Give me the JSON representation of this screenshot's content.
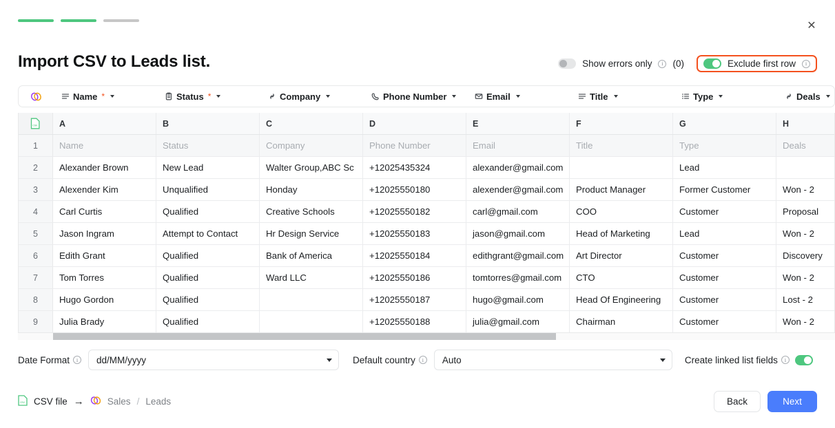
{
  "steps": [
    {
      "state": "done"
    },
    {
      "state": "done"
    },
    {
      "state": "todo"
    }
  ],
  "close_label": "✕",
  "title": "Import CSV to Leads list.",
  "header_controls": {
    "show_errors": {
      "label": "Show errors only",
      "count": "(0)",
      "on": false,
      "info": "ⓘ"
    },
    "exclude_first_row": {
      "label": "Exclude first row",
      "on": true,
      "highlighted": true
    }
  },
  "mapping": {
    "logo_icon": "twenty-logo-icon",
    "columns": [
      {
        "icon": "text-lines-icon",
        "label": "Name",
        "required": true
      },
      {
        "icon": "clipboard-icon",
        "label": "Status",
        "required": true
      },
      {
        "icon": "link-icon",
        "label": "Company",
        "required": false
      },
      {
        "icon": "phone-icon",
        "label": "Phone Number",
        "required": false
      },
      {
        "icon": "envelope-icon",
        "label": "Email",
        "required": false
      },
      {
        "icon": "text-lines-icon",
        "label": "Title",
        "required": false
      },
      {
        "icon": "list-icon",
        "label": "Type",
        "required": false
      },
      {
        "icon": "link-icon",
        "label": "Deals",
        "required": false
      }
    ]
  },
  "sheet": {
    "file_icon": "csv-file-icon",
    "column_letters": [
      "A",
      "B",
      "C",
      "D",
      "E",
      "F",
      "G",
      "H"
    ],
    "rows": [
      {
        "num": "1",
        "excluded": true,
        "cells": [
          "Name",
          "Status",
          "Company",
          "Phone Number",
          "Email",
          "Title",
          "Type",
          "Deals"
        ]
      },
      {
        "num": "2",
        "excluded": false,
        "cells": [
          "Alexander Brown",
          "New Lead",
          "Walter Group,ABC Sc",
          "+12025435324",
          "alexander@gmail.com",
          "",
          "Lead",
          ""
        ]
      },
      {
        "num": "3",
        "excluded": false,
        "cells": [
          "Alexender Kim",
          "Unqualified",
          "Honday",
          "+12025550180",
          "alexender@gmail.com",
          "Product Manager",
          "Former Customer",
          "Won - 2"
        ]
      },
      {
        "num": "4",
        "excluded": false,
        "cells": [
          "Carl Curtis",
          "Qualified",
          "Creative Schools",
          "+12025550182",
          "carl@gmail.com",
          "COO",
          "Customer",
          "Proposal"
        ]
      },
      {
        "num": "5",
        "excluded": false,
        "cells": [
          "Jason Ingram",
          "Attempt to Contact",
          "Hr Design Service",
          "+12025550183",
          "jason@gmail.com",
          "Head of Marketing",
          "Lead",
          "Won - 2"
        ]
      },
      {
        "num": "6",
        "excluded": false,
        "cells": [
          "Edith Grant",
          "Qualified",
          "Bank of America",
          "+12025550184",
          "edithgrant@gmail.com",
          "Art Director",
          "Customer",
          "Discovery"
        ]
      },
      {
        "num": "7",
        "excluded": false,
        "cells": [
          "Tom Torres",
          "Qualified",
          "Ward LLC",
          "+12025550186",
          "tomtorres@gmail.com",
          "CTO",
          "Customer",
          "Won - 2"
        ]
      },
      {
        "num": "8",
        "excluded": false,
        "cells": [
          "Hugo Gordon",
          "Qualified",
          "",
          "+12025550187",
          "hugo@gmail.com",
          "Head Of Engineering",
          "Customer",
          "Lost - 2"
        ]
      },
      {
        "num": "9",
        "excluded": false,
        "cells": [
          "Julia Brady",
          "Qualified",
          "",
          "+12025550188",
          "julia@gmail.com",
          "Chairman",
          "Customer",
          "Won - 2"
        ]
      }
    ]
  },
  "options": {
    "date_format": {
      "label": "Date Format",
      "value": "dd/MM/yyyy",
      "info": "ⓘ"
    },
    "default_country": {
      "label": "Default country",
      "value": "Auto",
      "info": "ⓘ"
    },
    "create_linked": {
      "label": "Create linked list fields",
      "on": true,
      "info": "ⓘ"
    }
  },
  "footer": {
    "breadcrumb": {
      "source": "CSV file",
      "arrow": "→",
      "workspace": "Sales",
      "separator": "/",
      "target": "Leads"
    },
    "back_label": "Back",
    "next_label": "Next"
  },
  "colors": {
    "accent_green": "#4ec77f",
    "primary_blue": "#4a7dfc",
    "highlight_orange": "#f4511e"
  }
}
